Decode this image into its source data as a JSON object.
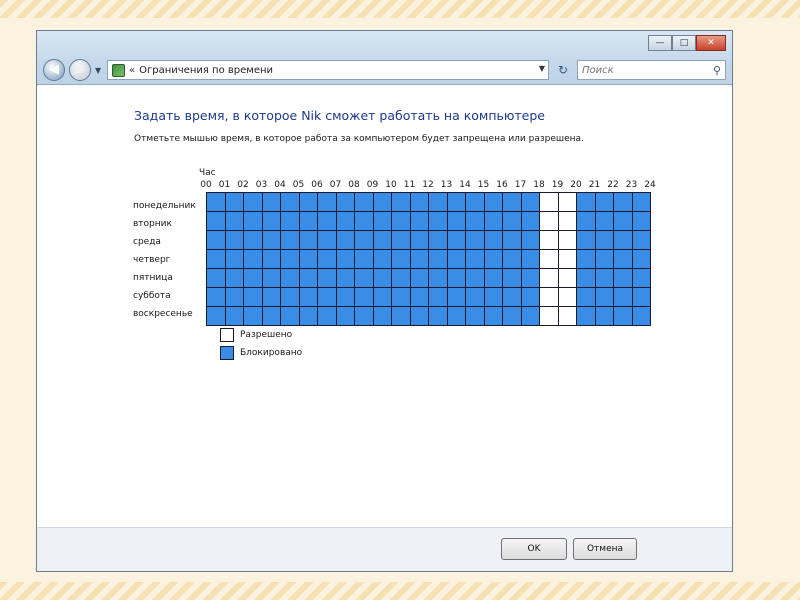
{
  "address": {
    "breadcrumb_sep": "«",
    "location": "Ограничения по времени"
  },
  "search": {
    "placeholder": "Поиск"
  },
  "caption": {
    "minimize": "—",
    "maximize": "□",
    "close": "✕"
  },
  "main": {
    "heading": "Задать время, в которое Nik сможет работать на компьютере",
    "instructions": "Отметьте мышью время, в которое работа за компьютером будет запрещена или разрешена.",
    "hour_label": "Час",
    "hours": [
      "00",
      "01",
      "02",
      "03",
      "04",
      "05",
      "06",
      "07",
      "08",
      "09",
      "10",
      "11",
      "12",
      "13",
      "14",
      "15",
      "16",
      "17",
      "18",
      "19",
      "20",
      "21",
      "22",
      "23",
      "24"
    ],
    "days": [
      "понедельник",
      "вторник",
      "среда",
      "четверг",
      "пятница",
      "суббота",
      "воскресенье"
    ],
    "allowed_hours": [
      18,
      19
    ],
    "colors": {
      "blocked": "#3a8de6",
      "allowed": "#ffffff"
    }
  },
  "legend": {
    "allowed": "Разрешено",
    "blocked": "Блокировано"
  },
  "buttons": {
    "ok": "OK",
    "cancel": "Отмена"
  }
}
